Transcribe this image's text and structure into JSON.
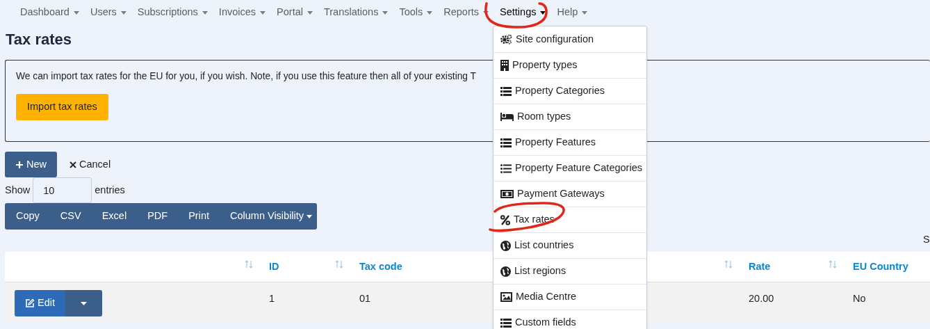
{
  "nav": [
    {
      "label": "Dashboard",
      "selected": false
    },
    {
      "label": "Users",
      "selected": false
    },
    {
      "label": "Subscriptions",
      "selected": false
    },
    {
      "label": "Invoices",
      "selected": false
    },
    {
      "label": "Portal",
      "selected": false
    },
    {
      "label": "Translations",
      "selected": false
    },
    {
      "label": "Tools",
      "selected": false
    },
    {
      "label": "Reports",
      "selected": false
    },
    {
      "label": "Settings",
      "selected": true
    },
    {
      "label": "Help",
      "selected": false
    }
  ],
  "page_title": "Tax rates",
  "info_box": {
    "text": "We can import tax rates for the EU for you, if you wish. Note, if you use this feature then all of your existing T",
    "button": "Import tax rates"
  },
  "actions": {
    "new": "New",
    "cancel": "Cancel"
  },
  "length": {
    "before": "Show",
    "value": "10",
    "after": "entries"
  },
  "export_buttons": [
    {
      "label": "Copy",
      "kind": "plain"
    },
    {
      "label": "CSV",
      "kind": "plain"
    },
    {
      "label": "Excel",
      "kind": "plain"
    },
    {
      "label": "PDF",
      "kind": "plain"
    },
    {
      "label": "Print",
      "kind": "plain"
    },
    {
      "label": "Column Visibility",
      "kind": "dropdown"
    }
  ],
  "search_label": "S",
  "table": {
    "columns": [
      {},
      {
        "label": "ID"
      },
      {
        "label": "Tax code"
      },
      {},
      {
        "label": "Rate"
      },
      {
        "label": "EU Country"
      }
    ],
    "rows": [
      {
        "cells": [
          "Edit",
          "1",
          "01",
          "",
          "20.00",
          "No"
        ]
      }
    ]
  },
  "settings_menu": [
    {
      "label": "Site configuration"
    },
    {
      "label": "Property types"
    },
    {
      "label": "Property Categories"
    },
    {
      "label": "Room types"
    },
    {
      "label": "Property Features"
    },
    {
      "label": "Property Feature Categories"
    },
    {
      "label": "Payment Gateways"
    },
    {
      "label": "Tax rates"
    },
    {
      "label": "List countries"
    },
    {
      "label": "List regions"
    },
    {
      "label": "Media Centre"
    },
    {
      "label": "Custom fields"
    }
  ]
}
